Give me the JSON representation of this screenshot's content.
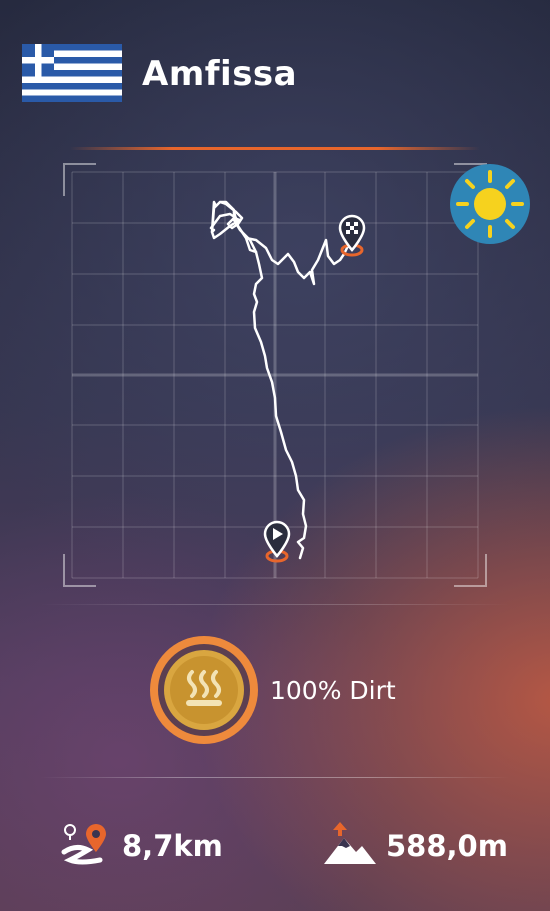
{
  "stage": {
    "name": "Amfissa",
    "country_flag": "greece-flag",
    "weather": "sunny",
    "surface": {
      "label": "100% Dirt",
      "icon": "heat-waves-icon"
    },
    "distance": "8,7km",
    "elevation": "588,0m"
  },
  "colors": {
    "accent_orange": "#e8662c",
    "weather_badge_blue": "#2f86b6",
    "sun_yellow": "#f6d21e",
    "coin_gold": "#d9a640",
    "flag_blue": "#2a5aa8"
  }
}
